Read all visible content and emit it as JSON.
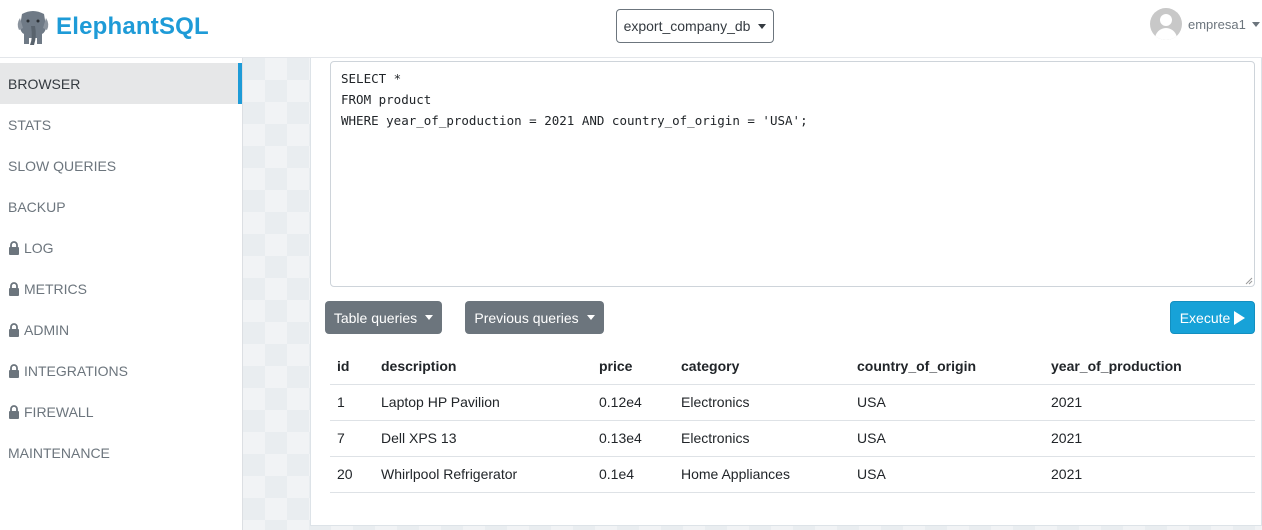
{
  "header": {
    "brand": "ElephantSQL",
    "database": "export_company_db",
    "username": "empresa1"
  },
  "sidebar": {
    "items": [
      {
        "label": "BROWSER",
        "locked": false,
        "active": true
      },
      {
        "label": "STATS",
        "locked": false
      },
      {
        "label": "SLOW QUERIES",
        "locked": false
      },
      {
        "label": "BACKUP",
        "locked": false
      },
      {
        "label": "LOG",
        "locked": true
      },
      {
        "label": "METRICS",
        "locked": true
      },
      {
        "label": "ADMIN",
        "locked": true
      },
      {
        "label": "INTEGRATIONS",
        "locked": true
      },
      {
        "label": "FIREWALL",
        "locked": true
      },
      {
        "label": "MAINTENANCE",
        "locked": false
      }
    ]
  },
  "editor": {
    "query": "SELECT *\nFROM product\nWHERE year_of_production = 2021 AND country_of_origin = 'USA';"
  },
  "toolbar": {
    "table_queries_label": "Table queries",
    "previous_queries_label": "Previous queries",
    "execute_label": "Execute"
  },
  "results": {
    "columns": [
      "id",
      "description",
      "price",
      "category",
      "country_of_origin",
      "year_of_production"
    ],
    "rows": [
      [
        "1",
        "Laptop HP Pavilion",
        "0.12e4",
        "Electronics",
        "USA",
        "2021"
      ],
      [
        "7",
        "Dell XPS 13",
        "0.13e4",
        "Electronics",
        "USA",
        "2021"
      ],
      [
        "20",
        "Whirlpool Refrigerator",
        "0.1e4",
        "Home Appliances",
        "USA",
        "2021"
      ]
    ]
  },
  "colors": {
    "brand": "#1e9bd7",
    "execute": "#17a2d8",
    "secondary_button": "#6c757d"
  },
  "icons": [
    "elephant-logo-icon",
    "caret-down-icon",
    "avatar-icon",
    "lock-icon",
    "play-icon"
  ]
}
